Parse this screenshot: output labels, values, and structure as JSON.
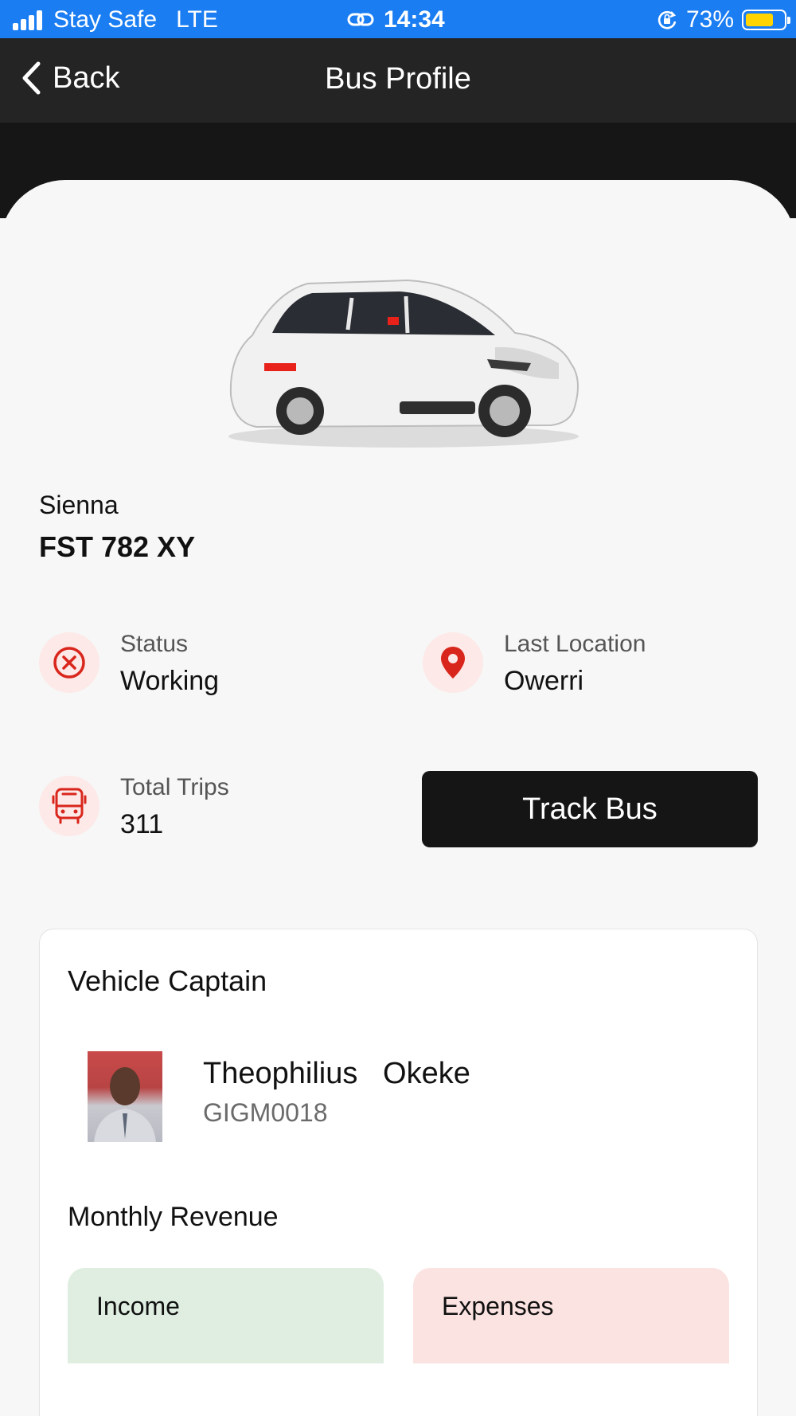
{
  "status_bar": {
    "carrier": "Stay Safe",
    "network": "LTE",
    "time": "14:34",
    "battery": "73%",
    "battery_level": 0.73
  },
  "nav": {
    "back_label": "Back",
    "title": "Bus Profile"
  },
  "vehicle": {
    "model": "Sienna",
    "plate": "FST 782 XY"
  },
  "info": {
    "status_label": "Status",
    "status_value": "Working",
    "location_label": "Last Location",
    "location_value": "Owerri",
    "trips_label": "Total Trips",
    "trips_value": "311"
  },
  "track_button": "Track Bus",
  "captain": {
    "section_title": "Vehicle Captain",
    "name": "Theophilius   Okeke",
    "id": "GIGM0018"
  },
  "revenue": {
    "section_title": "Monthly Revenue",
    "income_label": "Income",
    "expenses_label": "Expenses"
  },
  "colors": {
    "status_bar": "#1a7df2",
    "accent_red": "#d9261c",
    "icon_bg": "#fde9e7",
    "button_dark": "#151515",
    "income_bg": "#dfeee1",
    "expenses_bg": "#fbe3e1"
  }
}
